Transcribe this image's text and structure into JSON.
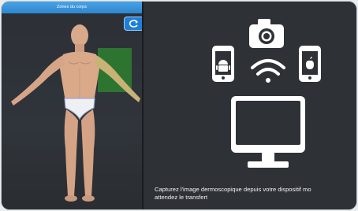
{
  "left_panel": {
    "title": "Zones du corps"
  },
  "icons": {
    "rotate": "rotate-icon",
    "phone_android": "android-phone-icon",
    "camera": "camera-icon",
    "wifi": "wifi-icon",
    "phone_apple": "apple-phone-icon",
    "monitor": "monitor-icon"
  },
  "right_panel": {
    "instruction_line1": "Capturez l'image dermoscopique depuis votre dispositif mo",
    "instruction_line2": "attendez le transfert"
  },
  "colors": {
    "title_bar": "#3a95dc",
    "selected_zone": "#2e8b2e",
    "icon_white": "#ffffff",
    "background_dark": "#2e3136"
  }
}
